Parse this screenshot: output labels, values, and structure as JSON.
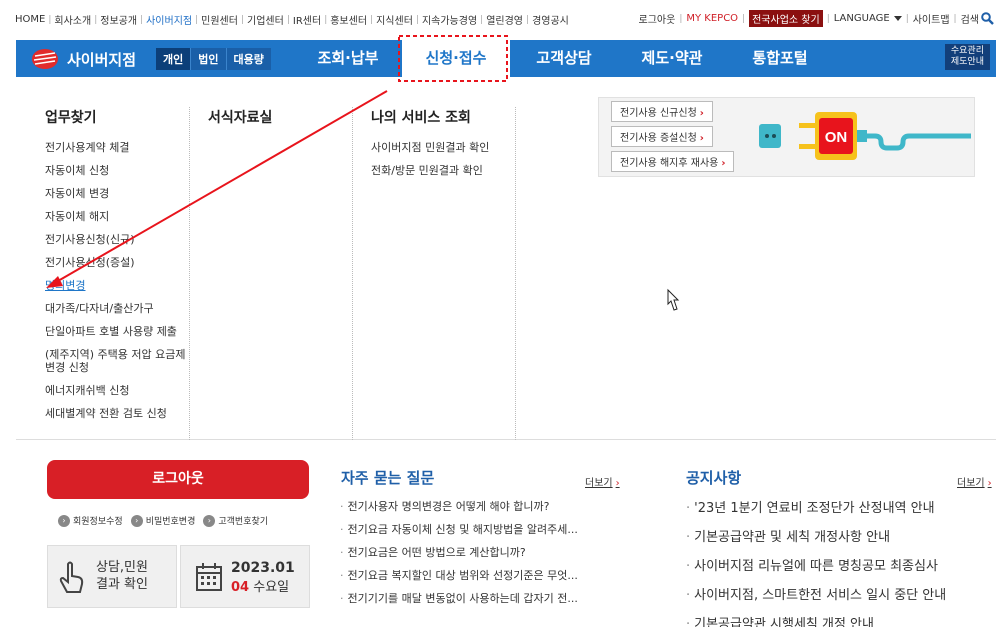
{
  "util_left": [
    "HOME",
    "회사소개",
    "정보공개",
    "사이버지점",
    "민원센터",
    "기업센터",
    "IR센터",
    "홍보센터",
    "지식센터",
    "지속가능경영",
    "열린경영",
    "경영공시"
  ],
  "util_right": {
    "logout": "로그아웃",
    "mykepco": "MY KEPCO",
    "find_office": "전국사업소 찾기",
    "language": "LANGUAGE",
    "sitemap": "사이트맵",
    "search": "검색"
  },
  "gnb": {
    "brand": "사이버지점",
    "segments": [
      "개인",
      "법인",
      "대용량"
    ],
    "menu": [
      "조회·납부",
      "신청·접수",
      "고객상담",
      "제도·약관",
      "통합포털"
    ],
    "demand_line1": "수요관리",
    "demand_line2": "제도안내"
  },
  "dropdown": {
    "col1": {
      "title": "업무찾기",
      "items": [
        "전기사용계약 체결",
        "자동이체 신청",
        "자동이체 변경",
        "자동이체 해지",
        "전기사용신청(신규)",
        "전기사용신청(증설)",
        "명의변경",
        "대가족/다자녀/출산가구",
        "단일아파트 호별 사용량 제출",
        "(제주지역) 주택용 저압 요금제 변경 신청",
        "에너지캐쉬백 신청",
        "세대별계약 전환 검토 신청"
      ]
    },
    "col2": {
      "title": "서식자료실"
    },
    "col3": {
      "title": "나의 서비스 조회",
      "items": [
        "사이버지점 민원결과 확인",
        "전화/방문 민원결과 확인"
      ]
    },
    "banner": {
      "buttons": [
        "전기사용 신규신청",
        "전기사용 증설신청",
        "전기사용 해지후 재사용"
      ],
      "on_label": "ON"
    }
  },
  "bottom": {
    "logout_button": "로그아웃",
    "links": [
      "회원정보수정",
      "비밀번호변경",
      "고객번호찾기"
    ],
    "inquiry_line1": "상담,민원",
    "inquiry_line2": "결과 확인",
    "date_ym": "2023.01",
    "date_day": "04",
    "date_weekday": "수요일",
    "faq_title": "자주 묻는 질문",
    "faq_more": "더보기",
    "faq": [
      "전기사용자 명의변경은 어떻게 해야 합니까?",
      "전기요금 자동이체 신청 및 해지방법을 알려주세...",
      "전기요금은 어떤 방법으로 계산합니까?",
      "전기요금 복지할인 대상 범위와 선정기준은 무엇...",
      "전기기기를 매달 변동없이 사용하는데 갑자기 전..."
    ],
    "notice_title": "공지사항",
    "notice_more": "더보기",
    "notices": [
      "'23년 1분기 연료비 조정단가 산정내역 안내",
      "기본공급약관 및 세칙 개정사항 안내",
      "사이버지점 리뉴얼에 따른 명칭공모 최종심사",
      "사이버지점, 스마트한전 서비스 일시 중단 안내",
      "기본공급약관 시행세칙 개정 안내"
    ]
  },
  "colors": {
    "brand_blue": "#1f76c8",
    "red": "#d81f26",
    "highlight_dash": "#e8141c"
  }
}
